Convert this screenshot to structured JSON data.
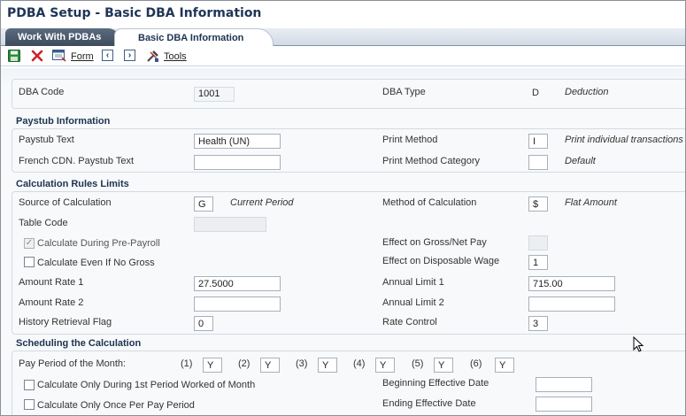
{
  "window": {
    "title": "PDBA Setup - Basic DBA Information"
  },
  "tabs": [
    {
      "label": "Work With PDBAs"
    },
    {
      "label": "Basic DBA Information"
    }
  ],
  "toolbar": {
    "form_label": "Form",
    "tools_label": "Tools"
  },
  "header": {
    "dba_code_label": "DBA Code",
    "dba_code_value": "1001",
    "dba_type_label": "DBA Type",
    "dba_type_value": "D",
    "dba_type_desc": "Deduction"
  },
  "paystub": {
    "title": "Paystub Information",
    "paystub_text_label": "Paystub Text",
    "paystub_text_value": "Health (UN)",
    "french_label": "French CDN. Paystub Text",
    "french_value": "",
    "print_method_label": "Print Method",
    "print_method_value": "I",
    "print_method_desc": "Print individual transactions",
    "print_category_label": "Print Method Category",
    "print_category_value": "",
    "print_category_desc": "Default"
  },
  "calc": {
    "title": "Calculation Rules Limits",
    "source_label": "Source of Calculation",
    "source_value": "G",
    "source_desc": "Current Period",
    "method_label": "Method of Calculation",
    "method_value": "$",
    "method_desc": "Flat Amount",
    "table_code_label": "Table Code",
    "table_code_value": "",
    "pre_payroll_label": "Calculate During Pre-Payroll",
    "pre_payroll_checked": true,
    "no_gross_label": "Calculate Even If No Gross",
    "no_gross_checked": false,
    "effect_gross_label": "Effect on Gross/Net Pay",
    "effect_gross_value": "",
    "effect_disp_label": "Effect on Disposable Wage",
    "effect_disp_value": "1",
    "amount_rate1_label": "Amount Rate 1",
    "amount_rate1_value": "27.5000",
    "amount_rate2_label": "Amount Rate 2",
    "amount_rate2_value": "",
    "annual_limit1_label": "Annual Limit 1",
    "annual_limit1_value": "715.00",
    "annual_limit2_label": "Annual Limit 2",
    "annual_limit2_value": "",
    "history_label": "History Retrieval Flag",
    "history_value": "0",
    "rate_control_label": "Rate Control",
    "rate_control_value": "3"
  },
  "schedule": {
    "title": "Scheduling the Calculation",
    "pay_period_label": "Pay Period of the Month:",
    "periods": [
      {
        "label": "(1)",
        "value": "Y"
      },
      {
        "label": "(2)",
        "value": "Y"
      },
      {
        "label": "(3)",
        "value": "Y"
      },
      {
        "label": "(4)",
        "value": "Y"
      },
      {
        "label": "(5)",
        "value": "Y"
      },
      {
        "label": "(6)",
        "value": "Y"
      }
    ],
    "first_period_label": "Calculate Only During 1st Period Worked of Month",
    "once_per_pay_label": "Calculate Only Once Per Pay Period",
    "begin_date_label": "Beginning Effective Date",
    "begin_date_value": "",
    "end_date_label": "Ending Effective Date",
    "end_date_value": ""
  },
  "colors": {
    "accent": "#1d3350",
    "save_green": "#2e8b3d",
    "cancel_red": "#d0202a"
  },
  "icons": [
    "save-icon",
    "cancel-icon",
    "form-icon",
    "previous-icon",
    "next-icon",
    "tools-icon"
  ]
}
